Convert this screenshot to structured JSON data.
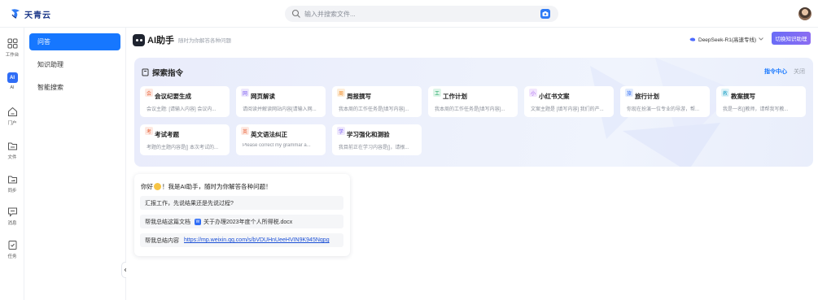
{
  "app": {
    "logo_text": "天青云"
  },
  "search": {
    "placeholder": "输入并搜索文件..."
  },
  "rail": [
    {
      "label": "工作台",
      "icon": "grid-icon"
    },
    {
      "label": "AI",
      "icon": "ai-icon"
    },
    {
      "label": "门户",
      "icon": "home-icon"
    },
    {
      "label": "文件",
      "icon": "folder-icon"
    },
    {
      "label": "同步",
      "icon": "sync-folder-icon"
    },
    {
      "label": "消息",
      "icon": "message-icon"
    },
    {
      "label": "任务",
      "icon": "task-icon"
    }
  ],
  "subnav": [
    {
      "label": "问答",
      "active": true
    },
    {
      "label": "知识助理",
      "active": false
    },
    {
      "label": "智能搜索",
      "active": false
    }
  ],
  "header": {
    "title": "AI助手",
    "subtitle": "随时为你解答各种问题",
    "model": "DeepSeek-R1(高速专线)",
    "switch_button": "切换知识助理"
  },
  "explore": {
    "title": "探索指令",
    "center_link": "指令中心",
    "close_link": "关闭",
    "cards": [
      {
        "tag": "会",
        "tag_color": "#e8633a",
        "tag_bg": "#fde9e2",
        "title": "会议纪要生成",
        "desc": "会议主题: [请输入内容] 会议内..."
      },
      {
        "tag": "网",
        "tag_color": "#7b5cf0",
        "tag_bg": "#eee8fd",
        "title": "网页解读",
        "desc": "请阅读并解读网站内容[请输入网..."
      },
      {
        "tag": "周",
        "tag_color": "#f0861d",
        "tag_bg": "#fdeedb",
        "title": "周报撰写",
        "desc": "我本周的工作任务是[填写内容]..."
      },
      {
        "tag": "工",
        "tag_color": "#1aa260",
        "tag_bg": "#def5e8",
        "title": "工作计划",
        "desc": "我本周的工作任务是[填写内容]..."
      },
      {
        "tag": "小",
        "tag_color": "#a35cf0",
        "tag_bg": "#f2e6fd",
        "title": "小红书文案",
        "desc": "文案主题是 [填写内容] 我们的产..."
      },
      {
        "tag": "旅",
        "tag_color": "#2f6df6",
        "tag_bg": "#e2ebfd",
        "title": "旅行计划",
        "desc": "你现在扮演一位专业的导游，帮..."
      },
      {
        "tag": "教",
        "tag_color": "#2ba6c9",
        "tag_bg": "#dff3f8",
        "title": "教案撰写",
        "desc": "我是一名[]教师，请帮我写教..."
      },
      {
        "tag": "考",
        "tag_color": "#e8633a",
        "tag_bg": "#fde9e2",
        "title": "考试考题",
        "desc": "考题的主题内容是[] 本次考试的..."
      },
      {
        "tag": "英",
        "tag_color": "#e8633a",
        "tag_bg": "#fde9e2",
        "title": "英文语法纠正",
        "desc": "Please correct my grammar a..."
      },
      {
        "tag": "学",
        "tag_color": "#7b5cf0",
        "tag_bg": "#eee8fd",
        "title": "学习强化和测验",
        "desc": "我目前正在学习内容是[]，请根..."
      }
    ]
  },
  "chat": {
    "greeting_before": "你好",
    "greeting_after": "！我是AI助手，随时为你解答各种问题！",
    "suggestion_1": "汇报工作，先说结果还是先说过程?",
    "suggestion_2_prefix": "帮我总结这篇文档",
    "suggestion_2_doc": "关于办理2023年度个人所得税.docx",
    "suggestion_3_prefix": "帮我总结内容",
    "suggestion_3_link": "https://mp.weixin.qq.com/s/bVDUHnUeeHVIN9K945Nqpg"
  },
  "colors": {
    "accent": "#1677ff",
    "ai_brand": "#2f6df6",
    "switch_gradient_start": "#6a6cf6",
    "switch_gradient_end": "#8b6cf2"
  }
}
